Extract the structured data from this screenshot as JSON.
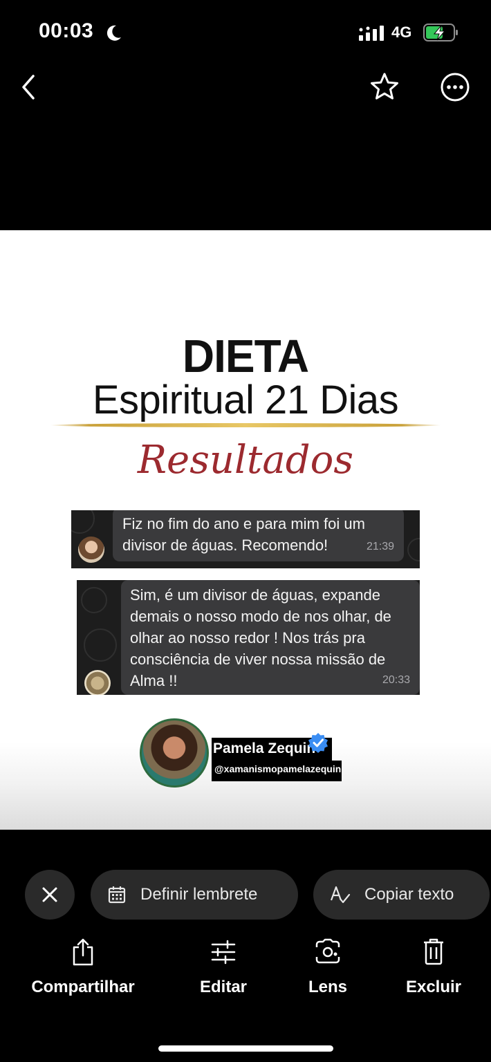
{
  "status_bar": {
    "time": "00:03",
    "network": "4G"
  },
  "post": {
    "title": "DIETA",
    "subtitle": "Espiritual 21 Dias",
    "heading": "Resultados",
    "chats": [
      {
        "text": "Fiz no fim do ano e para mim foi um divisor de águas. Recomendo!",
        "time": "21:39"
      },
      {
        "text": "Sim, é um divisor de águas, expande demais o nosso modo de nos olhar, de olhar ao nosso redor ! Nos trás pra consciência de viver nossa missão de Alma !!",
        "time": "20:33"
      }
    ],
    "profile": {
      "name": "Pamela Zequin",
      "handle": "@xamanismopamelazequin"
    }
  },
  "chips": {
    "reminder": "Definir lembrete",
    "copy": "Copiar texto"
  },
  "actions": {
    "share": "Compartilhar",
    "edit": "Editar",
    "lens": "Lens",
    "delete": "Excluir"
  }
}
